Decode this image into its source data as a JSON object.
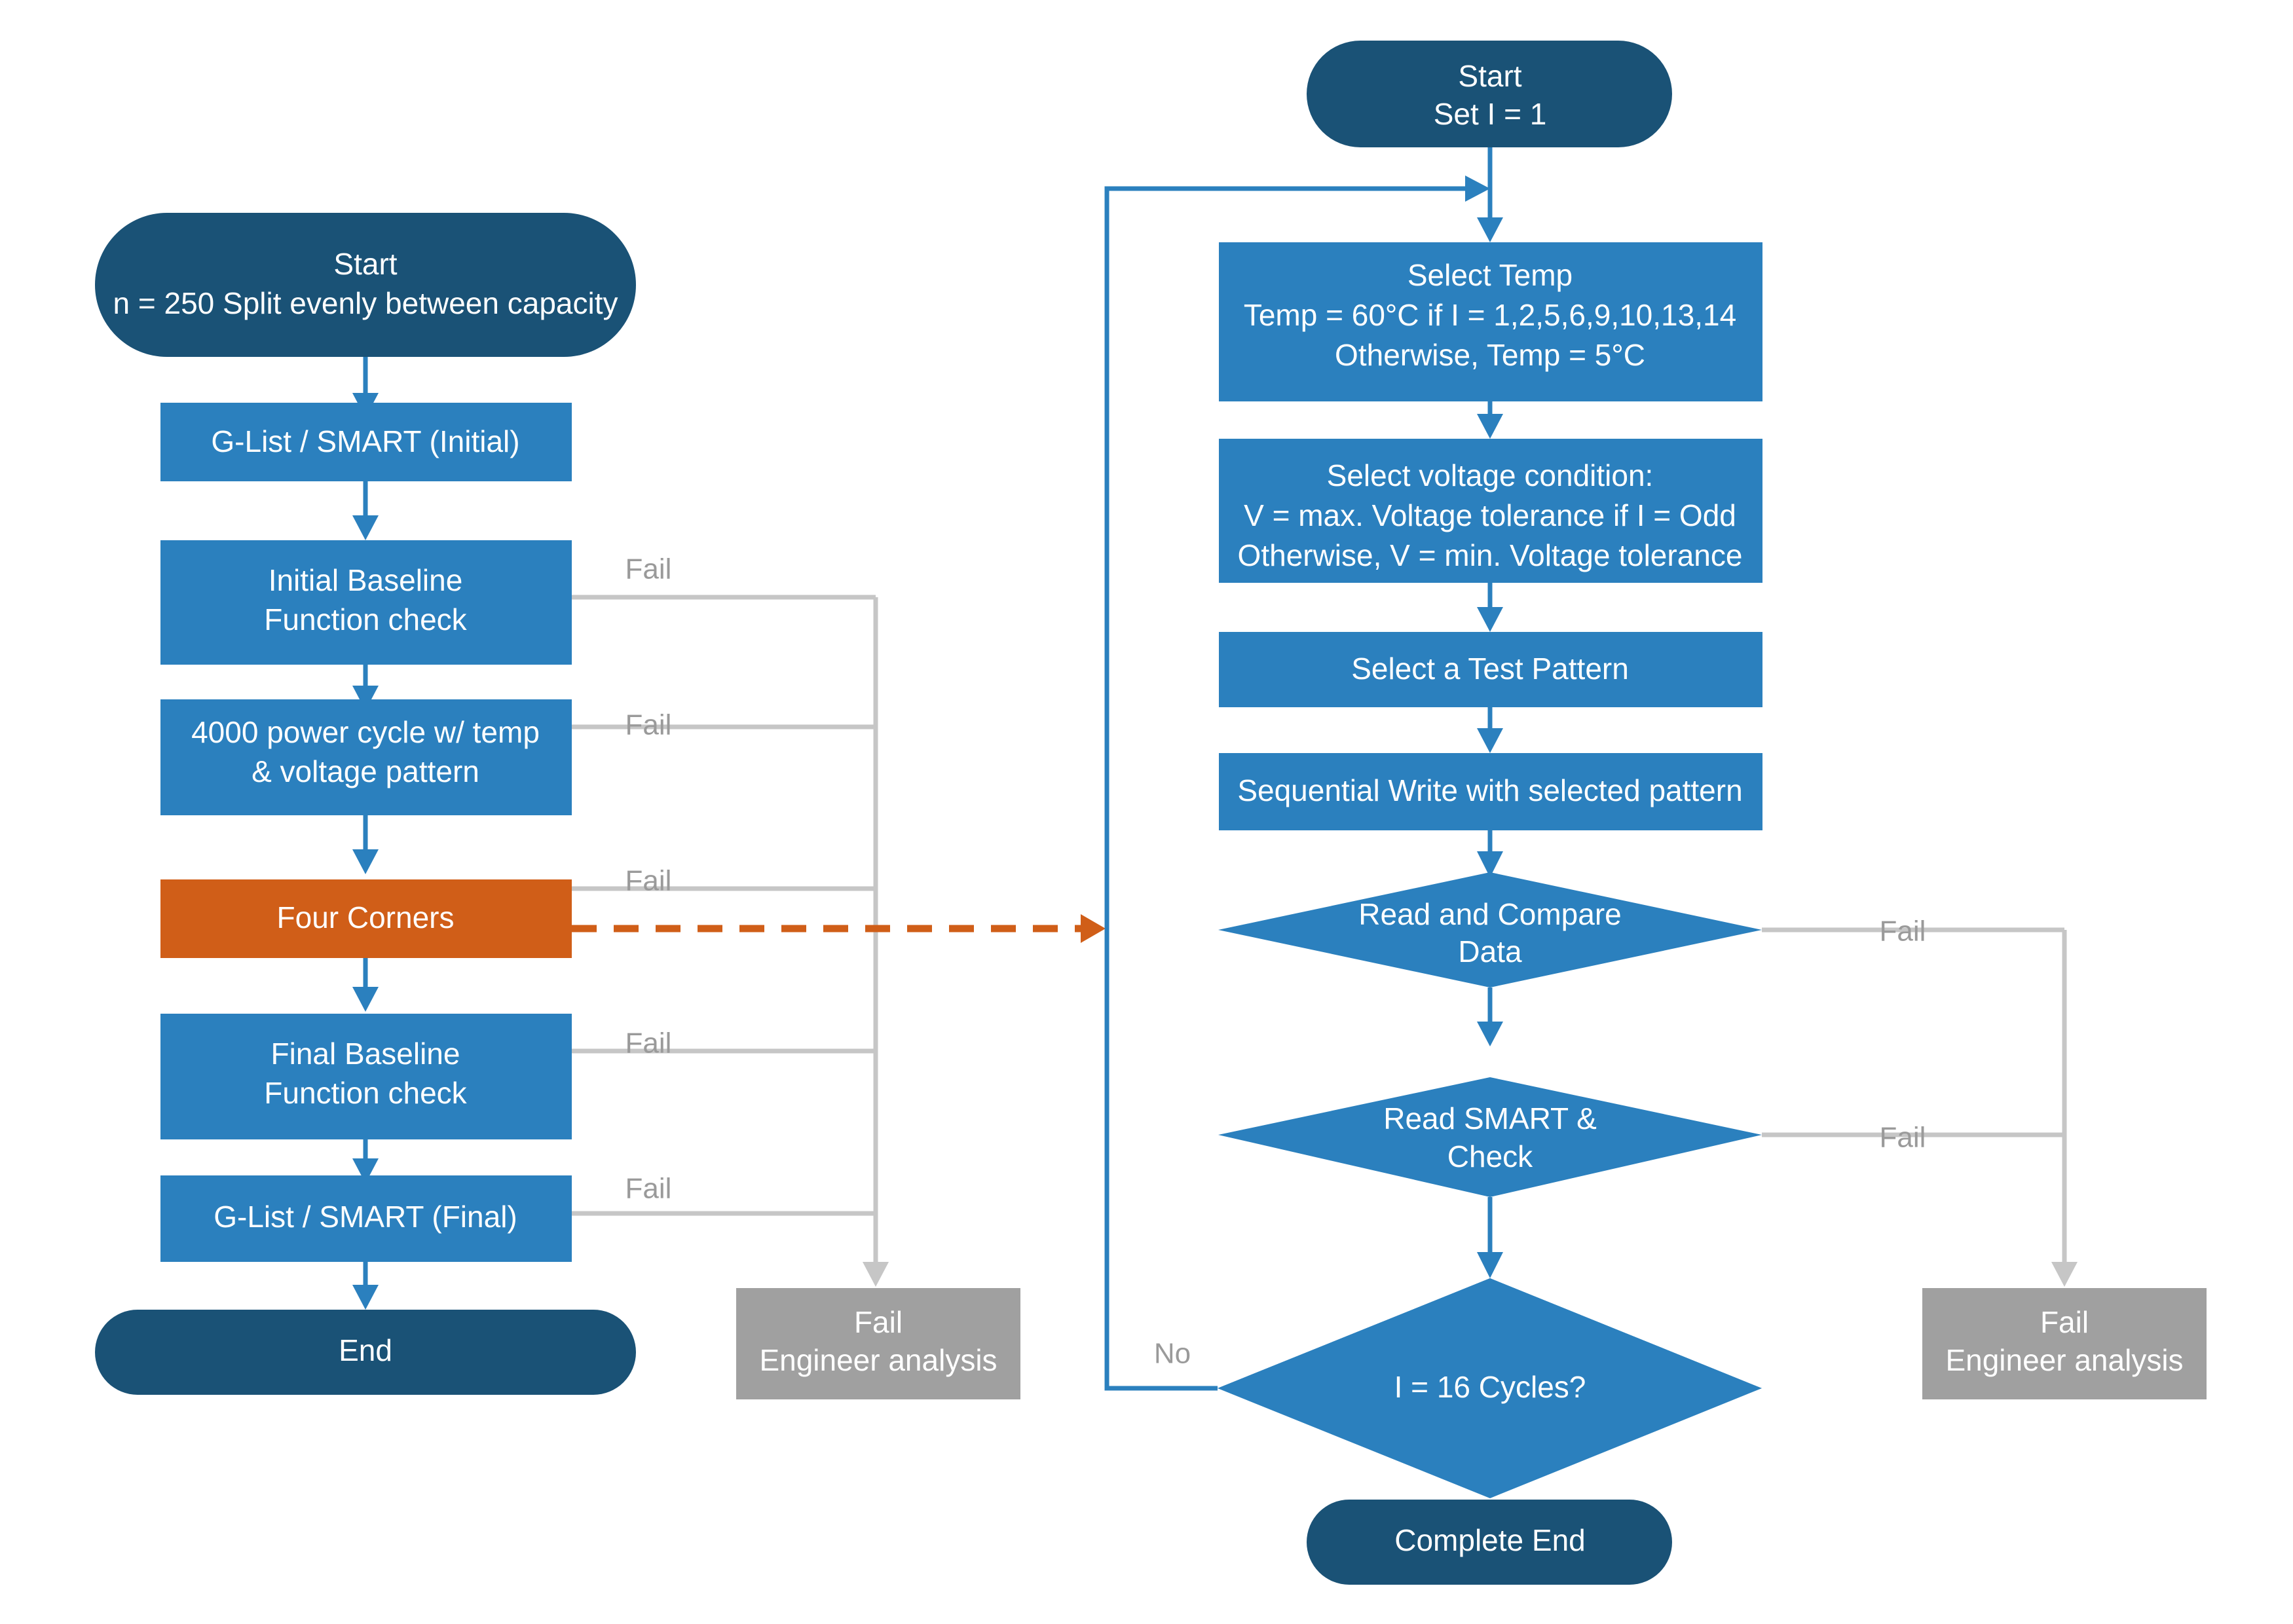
{
  "diagram": {
    "title": "SSD Reliability Test Flow",
    "colors": {
      "terminal": "#1A5276",
      "process": "#2B80BE",
      "highlight": "#D05E18",
      "fail": "#A0A0A0",
      "connector_blue": "#2B80BE",
      "connector_gray": "#c6c6c6",
      "connector_orange": "#D05E18",
      "background": "#FFFFFF",
      "node_text": "#FFFFFF",
      "edge_text": "#9A9A9A"
    }
  },
  "left_flow": {
    "start": {
      "line1": "Start",
      "line2": "n = 250 Split evenly between capacity"
    },
    "steps": [
      {
        "id": "glist-initial",
        "line1": "G-List / SMART (Initial)"
      },
      {
        "id": "initial-baseline",
        "line1": "Initial Baseline",
        "line2": "Function check"
      },
      {
        "id": "power-cycle",
        "line1": "4000 power cycle w/ temp",
        "line2": "& voltage pattern"
      },
      {
        "id": "four-corners",
        "line1": "Four Corners"
      },
      {
        "id": "final-baseline",
        "line1": "Final Baseline",
        "line2": "Function check"
      },
      {
        "id": "glist-final",
        "line1": "G-List / SMART (Final)"
      }
    ],
    "end": {
      "line1": "End"
    },
    "fail_labels": [
      "Fail",
      "Fail",
      "Fail",
      "Fail",
      "Fail"
    ],
    "fail_box": {
      "line1": "Fail",
      "line2": "Engineer analysis"
    }
  },
  "right_flow": {
    "start": {
      "line1": "Start",
      "line2": "Set I = 1"
    },
    "steps": [
      {
        "id": "select-temp",
        "line1": "Select Temp",
        "line2": "Temp = 60°C if I = 1,2,5,6,9,10,13,14",
        "line3": "Otherwise, Temp = 5°C"
      },
      {
        "id": "select-voltage",
        "line1": "Select voltage condition:",
        "line2": "V = max. Voltage tolerance if I = Odd",
        "line3": "Otherwise, V = min. Voltage tolerance"
      },
      {
        "id": "select-pattern",
        "line1": "Select a Test Pattern"
      },
      {
        "id": "sequential-write",
        "line1": "Sequential Write with selected pattern"
      }
    ],
    "decisions": [
      {
        "id": "read-compare",
        "line1": "Read and Compare",
        "line2": "Data"
      },
      {
        "id": "read-smart",
        "line1": "Read SMART &",
        "line2": "Check"
      },
      {
        "id": "cycle-check",
        "line1": "I = 16 Cycles?"
      }
    ],
    "end": {
      "line1": "Complete End"
    },
    "fail_labels": [
      "Fail",
      "Fail"
    ],
    "no_label": "No",
    "fail_box": {
      "line1": "Fail",
      "line2": "Engineer analysis"
    }
  }
}
